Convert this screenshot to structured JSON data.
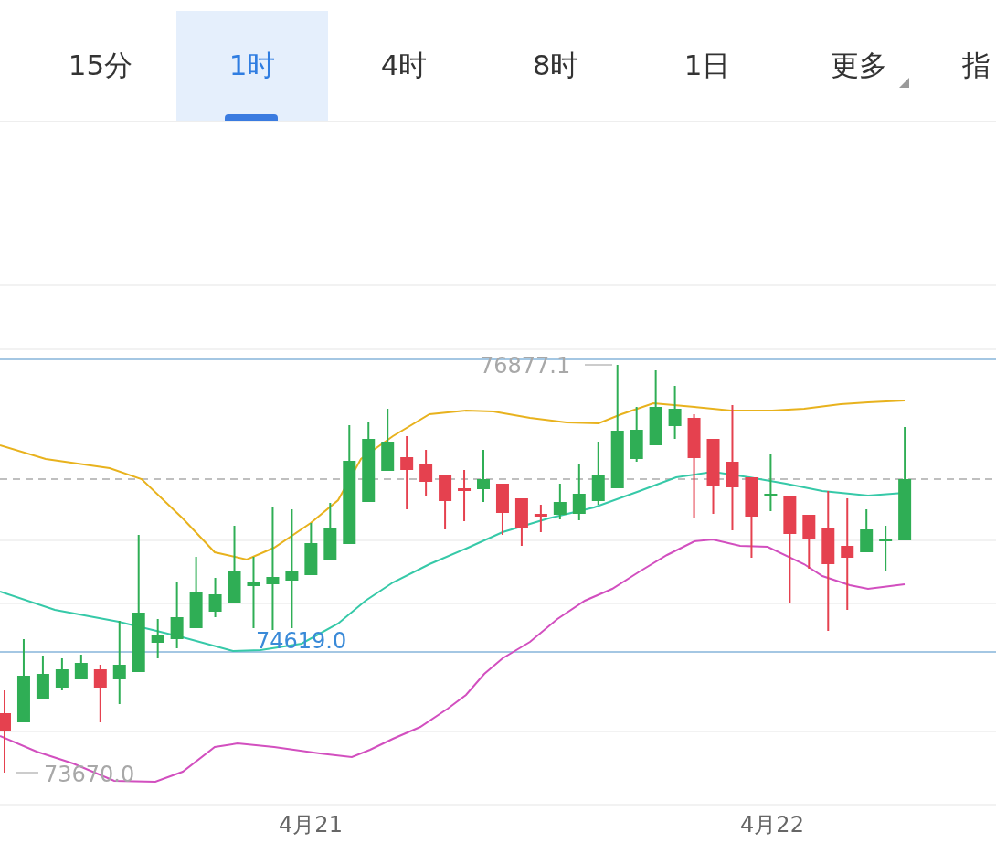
{
  "tabs": [
    {
      "label": "15分",
      "selected": false,
      "kind": "plain"
    },
    {
      "label": "1时",
      "selected": true,
      "kind": "plain"
    },
    {
      "label": "4时",
      "selected": false,
      "kind": "plain"
    },
    {
      "label": "8时",
      "selected": false,
      "kind": "plain"
    },
    {
      "label": "1日",
      "selected": false,
      "kind": "plain"
    },
    {
      "label": "更多",
      "selected": false,
      "kind": "dropdown"
    },
    {
      "label": "指",
      "selected": false,
      "kind": "cut"
    }
  ],
  "chart": {
    "high_label": "76877.1",
    "low_label": "73670.0",
    "price_line_label": "74619.0",
    "x_labels": [
      "4月21",
      "4月22"
    ]
  }
}
